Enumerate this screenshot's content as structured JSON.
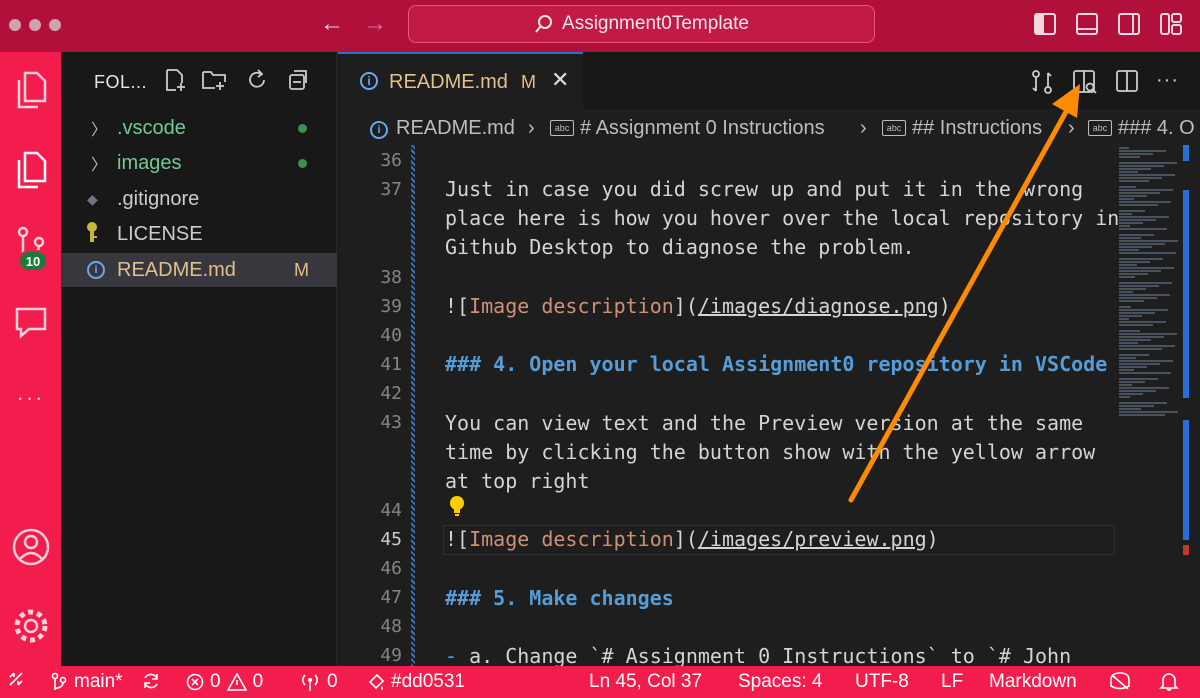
{
  "title_bar": {
    "search_text": "Assignment0Template"
  },
  "activity_bar": {
    "scm_badge": "10"
  },
  "sidebar": {
    "title": "FOL...",
    "items": [
      {
        "label": ".vscode",
        "type": "folder",
        "status": "untracked",
        "color": "#73c991"
      },
      {
        "label": "images",
        "type": "folder",
        "status": "untracked",
        "color": "#73c991"
      },
      {
        "label": ".gitignore",
        "type": "file",
        "color": "#cccccc"
      },
      {
        "label": "LICENSE",
        "type": "file",
        "color": "#cccccc"
      },
      {
        "label": "README.md",
        "type": "file",
        "status": "M",
        "color": "#e2c08d",
        "selected": true
      }
    ]
  },
  "editor": {
    "tab": {
      "label": "README.md",
      "status": "M"
    },
    "breadcrumbs": [
      "README.md",
      "# Assignment 0 Instructions",
      "## Instructions",
      "### 4. O"
    ],
    "line_numbers": [
      "36",
      "37",
      "38",
      "39",
      "40",
      "41",
      "42",
      "43",
      "44",
      "45",
      "46",
      "47",
      "48",
      "49"
    ],
    "active_line": "45",
    "lines": {
      "l37a": "Just in case you did screw up and put it in the wrong",
      "l37b": "place here is how you hover over the local repository in",
      "l37c": "Github Desktop to diagnose the problem.",
      "l39_bang": "![",
      "l39_text": "Image description",
      "l39_mid": "](",
      "l39_url": "/images/diagnose.png",
      "l39_end": ")",
      "l41": "### 4. Open your local Assignment0 repository in VSCode",
      "l43a": "You can view text and the Preview version at the same",
      "l43b": "time by clicking the button show with the yellow arrow",
      "l43c": "at top right",
      "l45_bang": "![",
      "l45_text": "Image description",
      "l45_mid": "](",
      "l45_url": "/images/preview.png",
      "l45_end": ")",
      "l47": "### 5. Make changes",
      "l49_dash": "-",
      "l49_rest": " a. Change `# Assignment 0 Instructions` to `# John"
    }
  },
  "status_bar": {
    "branch": "main*",
    "errors": "0",
    "warnings": "0",
    "ports": "0",
    "color_tag": "#dd0531",
    "cursor": "Ln 45, Col 37",
    "spaces": "Spaces: 4",
    "encoding": "UTF-8",
    "eol": "LF",
    "language": "Markdown"
  },
  "colors": {
    "title_bar": "#b0103a",
    "activity_bar": "#f21d4d",
    "status_bar": "#f21d4d",
    "annotation_arrow": "#ff8c00"
  }
}
